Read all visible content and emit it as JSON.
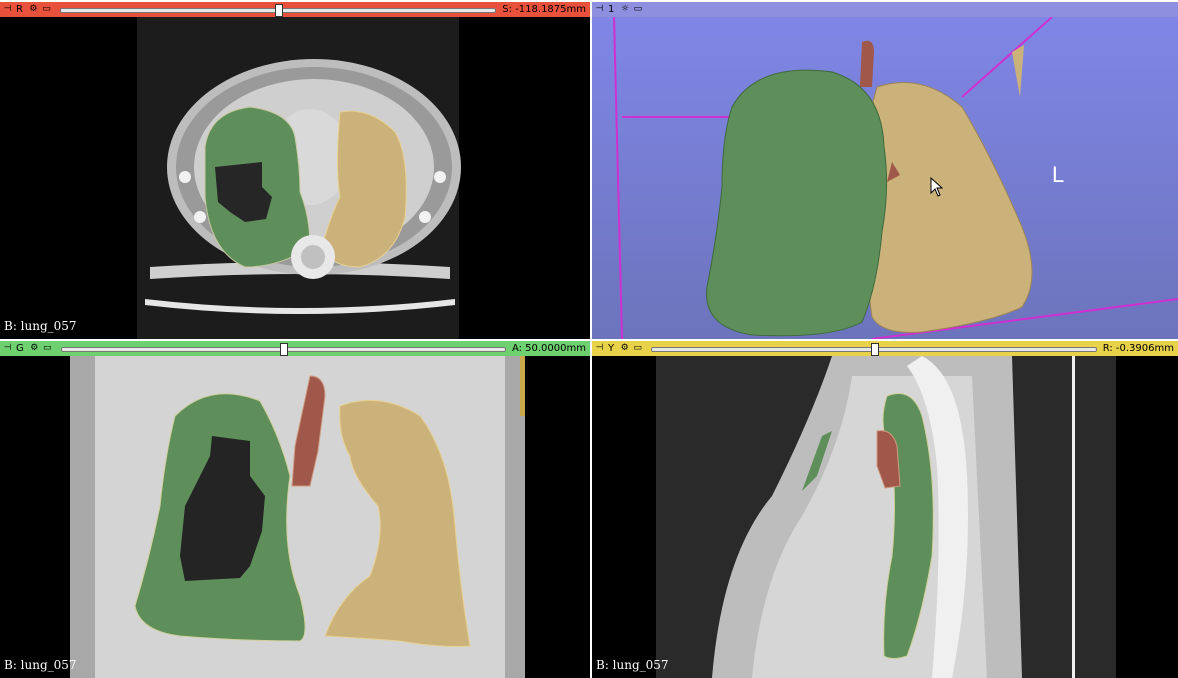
{
  "views": {
    "red": {
      "label": "R",
      "offset": "S: -118.1875mm",
      "color": "#e8513c",
      "slider_fraction": 0.5,
      "corner_text": "B: lung_057"
    },
    "threed": {
      "label": "1",
      "color": "#8f8fe0",
      "orientation_label": "L"
    },
    "green": {
      "label": "G",
      "offset": "A: 50.0000mm",
      "color": "#6fd06f",
      "slider_fraction": 0.5,
      "corner_text": "B: lung_057"
    },
    "yellow": {
      "label": "Y",
      "offset": "R: -0.3906mm",
      "color": "#e8d24a",
      "slider_fraction": 0.5,
      "corner_text": "B: lung_057"
    }
  },
  "colors": {
    "right_lung": "#5e8f5a",
    "left_lung": "#cbb27a",
    "trachea": "#a0584a",
    "render_bg": "#7d86d4"
  },
  "icons": [
    "pin-icon",
    "link-icon",
    "view-menu-icon",
    "settings-icon",
    "mouse-cursor-icon"
  ]
}
